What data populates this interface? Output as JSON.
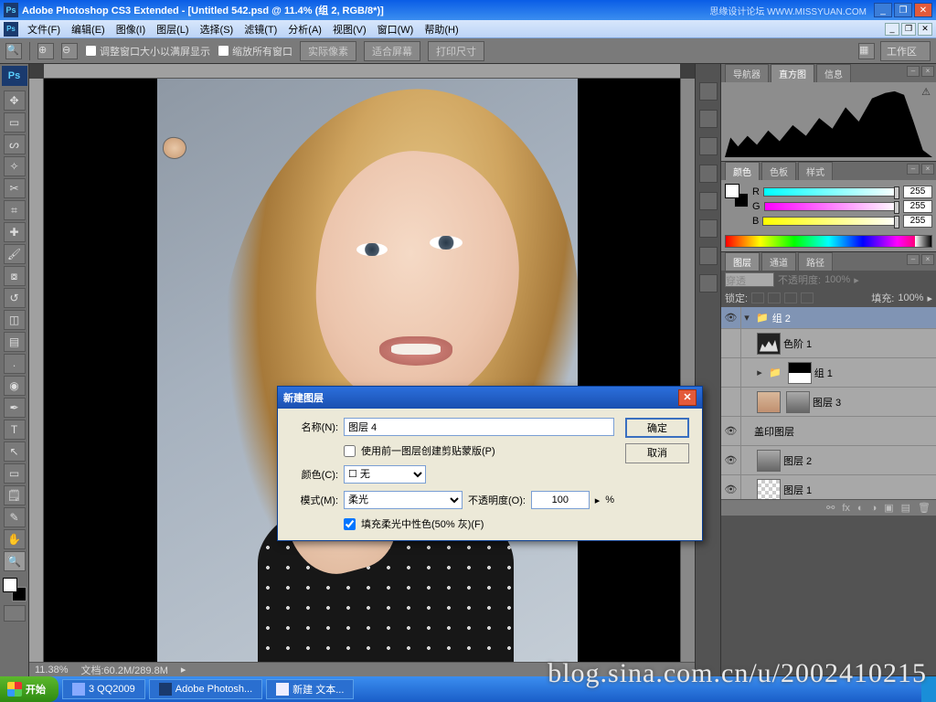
{
  "title": "Adobe Photoshop CS3 Extended - [Untitled 542.psd @ 11.4% (组 2, RGB/8*)]",
  "brand": "思缘设计论坛  WWW.MISSYUAN.COM",
  "menus": [
    "文件(F)",
    "编辑(E)",
    "图像(I)",
    "图层(L)",
    "选择(S)",
    "滤镜(T)",
    "分析(A)",
    "视图(V)",
    "窗口(W)",
    "帮助(H)"
  ],
  "options": {
    "resize_fill": "调整窗口大小以满屏显示",
    "zoom_all": "缩放所有窗口",
    "actual": "实际像素",
    "fit": "适合屏幕",
    "print": "打印尺寸",
    "workspace": "工作区"
  },
  "status": {
    "zoom": "11.38%",
    "doc": "文档:60.2M/289.8M"
  },
  "nav_tabs": [
    "导航器",
    "直方图",
    "信息"
  ],
  "color_tabs": [
    "颜色",
    "色板",
    "样式"
  ],
  "color": {
    "r": "255",
    "g": "255",
    "b": "255"
  },
  "layer_tabs": [
    "图层",
    "通道",
    "路径"
  ],
  "layer_opts": {
    "blend": "穿透",
    "opacity_lbl": "不透明度:",
    "opacity": "100%",
    "fill_lbl": "填充:",
    "fill": "100%",
    "lock_lbl": "锁定:"
  },
  "layers": {
    "group": "组 2",
    "l1": "色阶 1",
    "l2": "组 1",
    "l3": "图层 3",
    "l4": "盖印图层",
    "l5": "图层 2",
    "l6": "图层 1"
  },
  "dialog": {
    "title": "新建图层",
    "name_lbl": "名称(N):",
    "name_val": "图层 4",
    "clip_lbl": "使用前一图层创建剪贴蒙版(P)",
    "color_lbl": "颜色(C):",
    "color_val": "无",
    "mode_lbl": "模式(M):",
    "mode_val": "柔光",
    "opac_lbl": "不透明度(O):",
    "opac_val": "100",
    "opac_pct": "%",
    "fill_lbl": "填充柔光中性色(50% 灰)(F)",
    "ok": "确定",
    "cancel": "取消"
  },
  "taskbar": {
    "start": "开始",
    "qq": "3 QQ2009",
    "ps": "Adobe Photosh...",
    "txt": "新建 文本..."
  },
  "watermark": "blog.sina.com.cn/u/2002410215"
}
